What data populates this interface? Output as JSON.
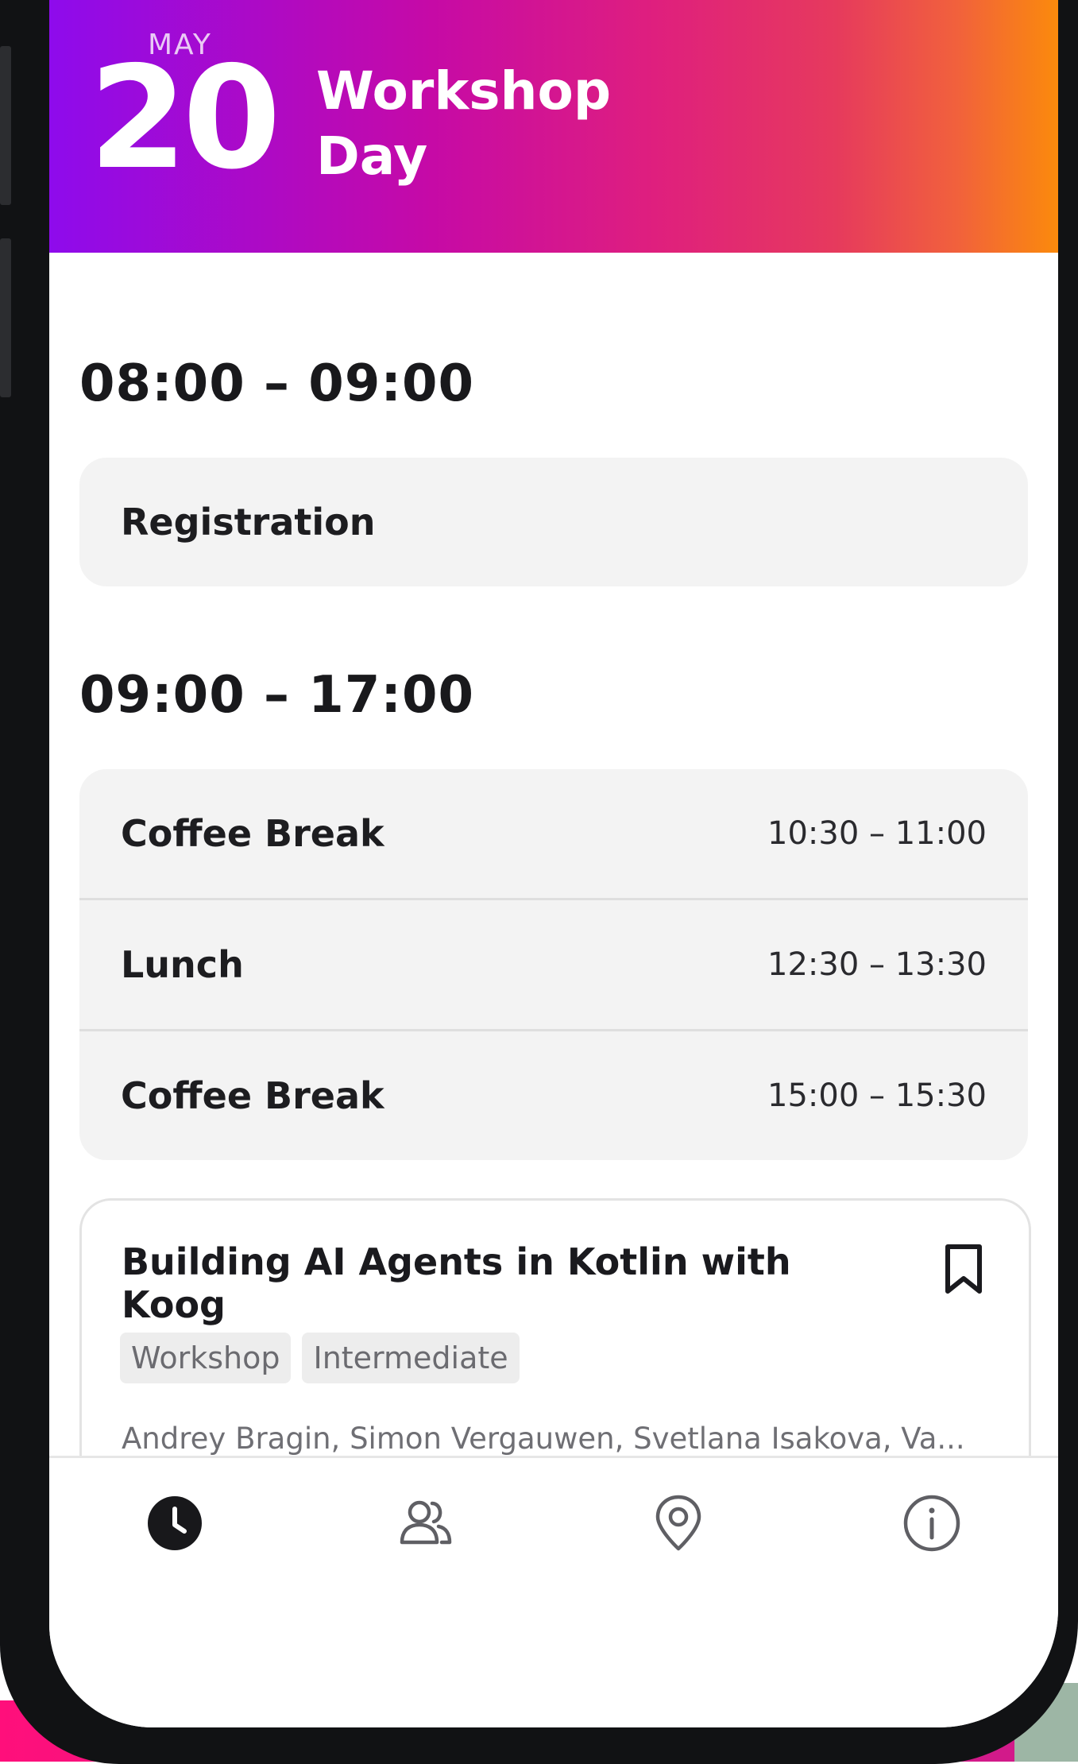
{
  "header": {
    "month": "MAY",
    "day": "20",
    "title": "Workshop Day"
  },
  "slots": [
    {
      "time": "08:00 – 09:00",
      "items": [
        {
          "title": "Registration",
          "time": ""
        }
      ]
    },
    {
      "time": "09:00 – 17:00",
      "items": [
        {
          "title": "Coffee Break",
          "time": "10:30 – 11:00"
        },
        {
          "title": "Lunch",
          "time": "12:30 – 13:30"
        },
        {
          "title": "Coffee Break",
          "time": "15:00 – 15:30"
        }
      ]
    }
  ],
  "session": {
    "title": "Building AI Agents in Kotlin with Koog",
    "tags": [
      "Workshop",
      "Intermediate"
    ],
    "speakers": "Andrey Bragin, Simon Vergauwen, Svetlana Isakova, Va...",
    "bookmark_icon": "bookmark-icon"
  },
  "nav": {
    "items": [
      {
        "icon": "clock-icon",
        "active": true
      },
      {
        "icon": "people-icon",
        "active": false
      },
      {
        "icon": "location-pin-icon",
        "active": false
      },
      {
        "icon": "info-icon",
        "active": false
      }
    ]
  },
  "colors": {
    "header_gradient_start": "#8e0bec",
    "header_gradient_mid": "#df1f7e",
    "header_gradient_end": "#fb8a0c",
    "card_bg": "#f3f3f3",
    "text_primary": "#19191c",
    "text_secondary": "#6f6f74"
  }
}
